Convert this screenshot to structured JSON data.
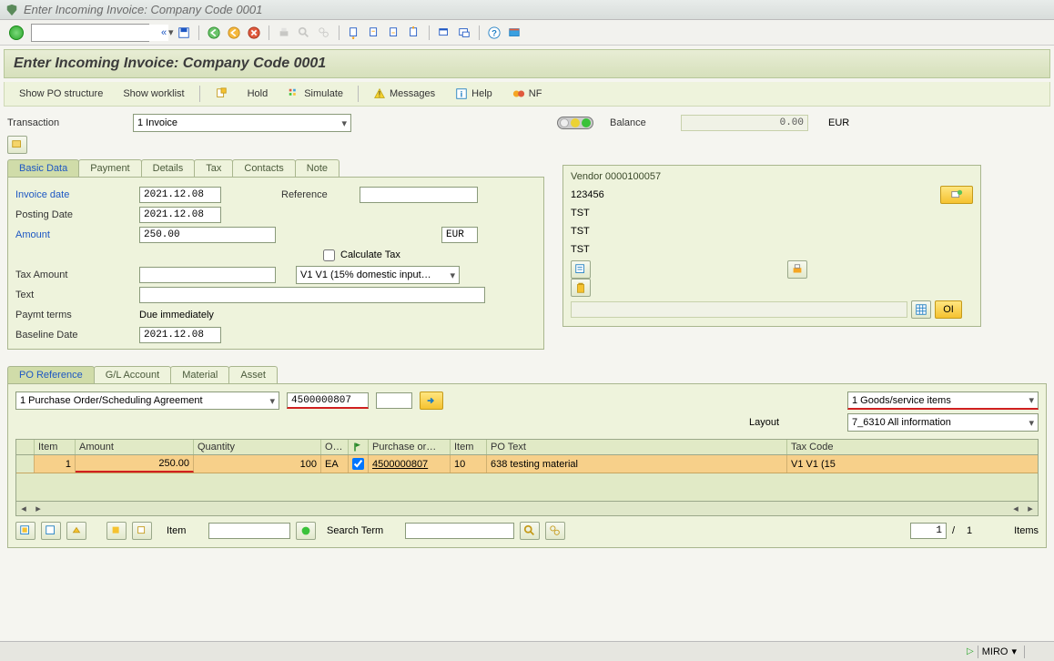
{
  "window_title": "Enter Incoming Invoice: Company Code 0001",
  "page_title": "Enter Incoming Invoice: Company Code 0001",
  "app_toolbar": {
    "show_po_structure": "Show PO structure",
    "show_worklist": "Show worklist",
    "hold": "Hold",
    "simulate": "Simulate",
    "messages": "Messages",
    "help": "Help",
    "nf": "NF"
  },
  "transaction": {
    "label": "Transaction",
    "value": "1 Invoice"
  },
  "balance": {
    "label": "Balance",
    "value": "0.00",
    "currency": "EUR"
  },
  "tabs1": [
    "Basic Data",
    "Payment",
    "Details",
    "Tax",
    "Contacts",
    "Note"
  ],
  "basic": {
    "invoice_date_lbl": "Invoice date",
    "invoice_date": "2021.12.08",
    "reference_lbl": "Reference",
    "reference": "",
    "posting_date_lbl": "Posting Date",
    "posting_date": "2021.12.08",
    "amount_lbl": "Amount",
    "amount": "250.00",
    "amount_curr": "EUR",
    "calc_tax_lbl": "Calculate Tax",
    "tax_amount_lbl": "Tax Amount",
    "tax_amount": "",
    "tax_code": "V1 V1 (15% domestic input…",
    "text_lbl": "Text",
    "text": "",
    "paymt_terms_lbl": "Paymt terms",
    "paymt_terms": "Due immediately",
    "baseline_lbl": "Baseline Date",
    "baseline": "2021.12.08"
  },
  "vendor": {
    "header": "Vendor 0000100057",
    "line1": "123456",
    "line2": "TST",
    "line3": "TST",
    "line4": "TST",
    "oi": "OI"
  },
  "tabs2": [
    "PO Reference",
    "G/L Account",
    "Material",
    "Asset"
  ],
  "po": {
    "ref_type": "1 Purchase Order/Scheduling Agreement",
    "po_number": "4500000807",
    "po_extra": "",
    "items_select": "1 Goods/service items",
    "layout_lbl": "Layout",
    "layout": "7_6310 All information"
  },
  "grid": {
    "headers": {
      "item": "Item",
      "amount": "Amount",
      "quantity": "Quantity",
      "ou": "O…",
      "po": "Purchase or…",
      "itm": "Item",
      "po_text": "PO Text",
      "tax": "Tax Code"
    },
    "row": {
      "item": "1",
      "amount": "250.00",
      "quantity": "100",
      "ou": "EA",
      "po": "4500000807",
      "itm": "10",
      "po_text": "638 testing material",
      "tax": "V1 V1 (15"
    }
  },
  "footer": {
    "item_lbl": "Item",
    "search_lbl": "Search Term",
    "pos": "1",
    "sep": "/",
    "total": "1",
    "items_lbl": "Items"
  },
  "status": {
    "tcode": "MIRO"
  }
}
